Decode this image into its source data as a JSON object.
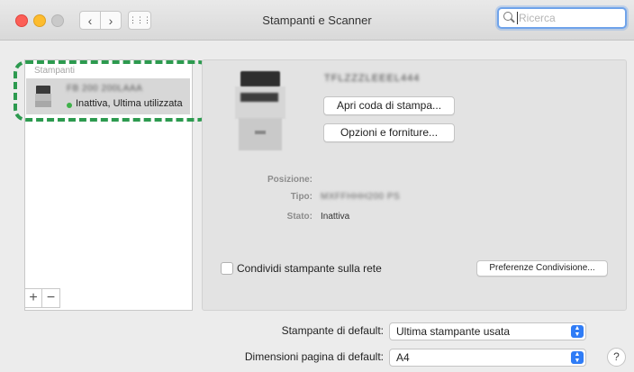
{
  "window": {
    "title": "Stampanti e Scanner"
  },
  "search": {
    "placeholder": "Ricerca"
  },
  "toolbar": {
    "back": "‹",
    "forward": "›",
    "grid": "⋮⋮⋮"
  },
  "printer_list": {
    "header": "Stampanti",
    "items": [
      {
        "name": "FB 200 200LAAA",
        "status": "Inattiva, Ultima utilizzata"
      }
    ],
    "add_label": "+",
    "remove_label": "−"
  },
  "detail": {
    "printer_title": "TFLZZZLEEEL444",
    "open_queue_button": "Apri coda di stampa...",
    "options_button": "Opzioni e forniture...",
    "location_label": "Posizione:",
    "location_value": "",
    "type_label": "Tipo:",
    "type_value": "MXFFHHH200 PS",
    "status_label": "Stato:",
    "status_value": "Inattiva",
    "share_label": "Condividi stampante sulla rete",
    "share_checked": false,
    "share_prefs_button": "Preferenze Condivisione..."
  },
  "defaults": {
    "printer_label": "Stampante di default:",
    "printer_value": "Ultima stampante usata",
    "paper_label": "Dimensioni pagina di default:",
    "paper_value": "A4"
  },
  "help": {
    "label": "?"
  },
  "colors": {
    "highlight_dash": "#2d9a4f",
    "status_dot": "#3fb14a",
    "popup_accent": "#2f7cf6"
  }
}
